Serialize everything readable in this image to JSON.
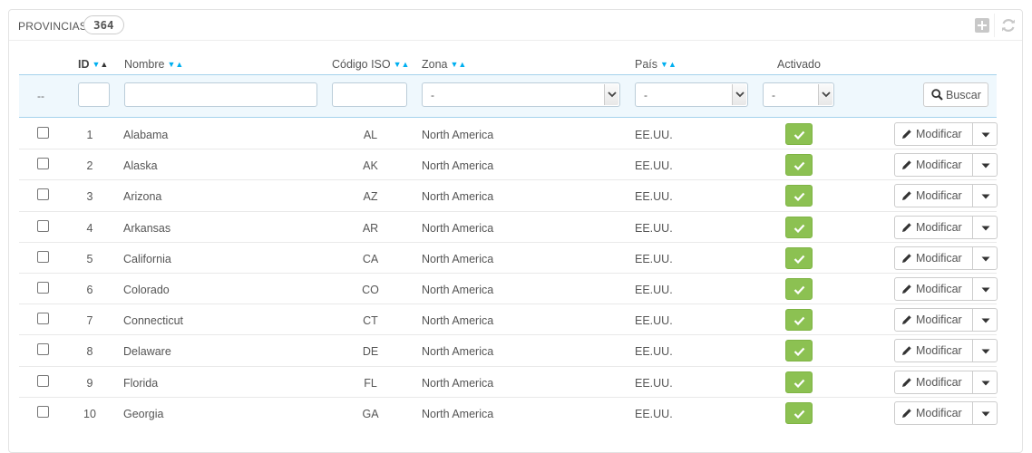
{
  "panel": {
    "title": "PROVINCIAS",
    "count": "364",
    "add_icon": "plus-square-icon",
    "refresh_icon": "refresh-icon"
  },
  "columns": {
    "id": "ID",
    "name": "Nombre",
    "iso": "Código ISO",
    "zone": "Zona",
    "country": "País",
    "active": "Activado"
  },
  "filters": {
    "bulk_placeholder": "--",
    "id_value": "",
    "name_value": "",
    "iso_value": "",
    "zone_selected": "-",
    "country_selected": "-",
    "active_selected": "-",
    "search_label": "Buscar",
    "search_icon": "search-icon"
  },
  "row_actions": {
    "edit_label": "Modificar",
    "edit_icon": "pencil-icon",
    "more_icon": "caret-down-icon",
    "active_icon": "check-icon"
  },
  "colors": {
    "active_green": "#8cc152",
    "sort_blue": "#00aff0",
    "filter_bg": "#eff8fd"
  },
  "rows": [
    {
      "id": "1",
      "name": "Alabama",
      "iso": "AL",
      "zone": "North America",
      "country": "EE.UU.",
      "active": true
    },
    {
      "id": "2",
      "name": "Alaska",
      "iso": "AK",
      "zone": "North America",
      "country": "EE.UU.",
      "active": true
    },
    {
      "id": "3",
      "name": "Arizona",
      "iso": "AZ",
      "zone": "North America",
      "country": "EE.UU.",
      "active": true
    },
    {
      "id": "4",
      "name": "Arkansas",
      "iso": "AR",
      "zone": "North America",
      "country": "EE.UU.",
      "active": true
    },
    {
      "id": "5",
      "name": "California",
      "iso": "CA",
      "zone": "North America",
      "country": "EE.UU.",
      "active": true
    },
    {
      "id": "6",
      "name": "Colorado",
      "iso": "CO",
      "zone": "North America",
      "country": "EE.UU.",
      "active": true
    },
    {
      "id": "7",
      "name": "Connecticut",
      "iso": "CT",
      "zone": "North America",
      "country": "EE.UU.",
      "active": true
    },
    {
      "id": "8",
      "name": "Delaware",
      "iso": "DE",
      "zone": "North America",
      "country": "EE.UU.",
      "active": true
    },
    {
      "id": "9",
      "name": "Florida",
      "iso": "FL",
      "zone": "North America",
      "country": "EE.UU.",
      "active": true
    },
    {
      "id": "10",
      "name": "Georgia",
      "iso": "GA",
      "zone": "North America",
      "country": "EE.UU.",
      "active": true
    }
  ]
}
